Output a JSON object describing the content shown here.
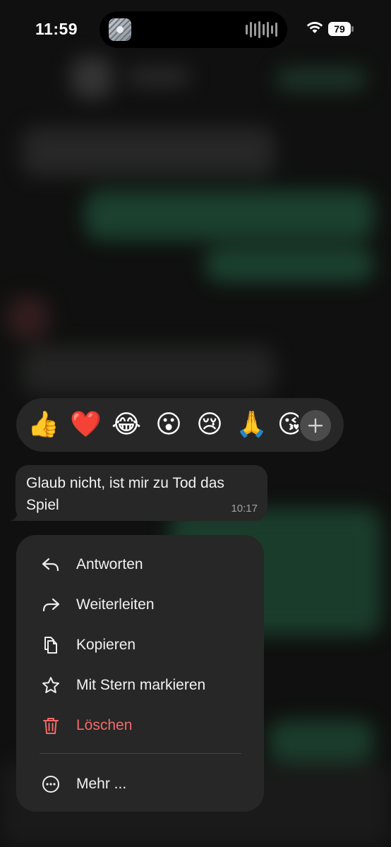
{
  "status_bar": {
    "time": "11:59",
    "battery": "79"
  },
  "reactions": {
    "emojis": [
      "👍",
      "❤️",
      "😂",
      "😮",
      "😢",
      "🙏",
      "😘"
    ],
    "more_icon": "plus-icon"
  },
  "message": {
    "text": "Glaub nicht, ist mir zu Tod das Spiel",
    "time": "10:17"
  },
  "menu": {
    "items": [
      {
        "label": "Antworten",
        "icon": "reply-icon"
      },
      {
        "label": "Weiterleiten",
        "icon": "forward-icon"
      },
      {
        "label": "Kopieren",
        "icon": "copy-icon"
      },
      {
        "label": "Mit Stern markieren",
        "icon": "star-icon"
      },
      {
        "label": "Löschen",
        "icon": "trash-icon"
      },
      {
        "label": "Mehr ...",
        "icon": "more-icon"
      }
    ]
  },
  "colors": {
    "danger": "#f26a6a",
    "panel": "#262726"
  }
}
